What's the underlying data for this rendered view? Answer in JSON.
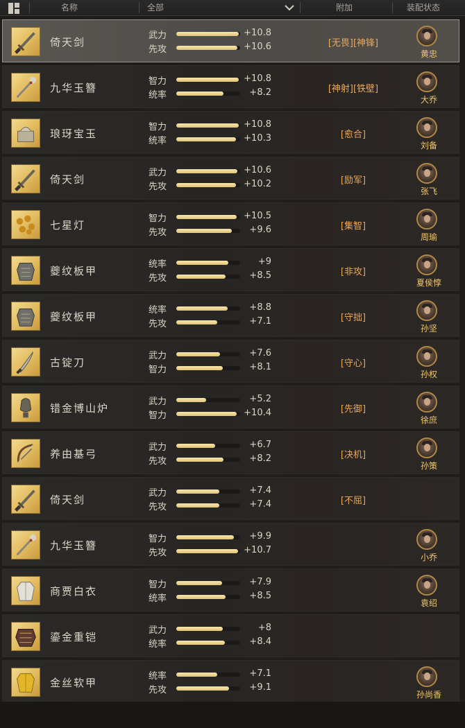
{
  "header": {
    "name_col": "名称",
    "filter_value": "全部",
    "extra_col": "附加",
    "equip_col": "装配状态",
    "layout_icon": "grid-toggle-icon",
    "dropdown_icon": "chevron-down-icon"
  },
  "colors": {
    "bar_fill": "#e8cc82",
    "tag_text": "#e8a85a",
    "owner_text": "#f0c86a",
    "selected_row": "#55524d"
  },
  "items": [
    {
      "name": "倚天剑",
      "icon": "sword-icon",
      "stats": [
        {
          "label": "武力",
          "value": "+10.8",
          "fill": 0.98
        },
        {
          "label": "先攻",
          "value": "+10.6",
          "fill": 0.96
        }
      ],
      "tags": "[无畏][神锋]",
      "owner": "黄忠",
      "selected": true
    },
    {
      "name": "九华玉簪",
      "icon": "hairpin-icon",
      "stats": [
        {
          "label": "智力",
          "value": "+10.8",
          "fill": 0.98
        },
        {
          "label": "统率",
          "value": "+8.2",
          "fill": 0.74
        }
      ],
      "tags": "[神射][铁壁]",
      "owner": "大乔"
    },
    {
      "name": "琅玡宝玉",
      "icon": "jade-seal-icon",
      "stats": [
        {
          "label": "智力",
          "value": "+10.8",
          "fill": 0.98
        },
        {
          "label": "统率",
          "value": "+10.3",
          "fill": 0.94
        }
      ],
      "tags": "[愈合]",
      "owner": "刘备"
    },
    {
      "name": "倚天剑",
      "icon": "sword-icon",
      "stats": [
        {
          "label": "武力",
          "value": "+10.6",
          "fill": 0.96
        },
        {
          "label": "先攻",
          "value": "+10.2",
          "fill": 0.93
        }
      ],
      "tags": "[励军]",
      "owner": "张飞"
    },
    {
      "name": "七星灯",
      "icon": "lamp-icon",
      "stats": [
        {
          "label": "智力",
          "value": "+10.5",
          "fill": 0.95
        },
        {
          "label": "先攻",
          "value": "+9.6",
          "fill": 0.87
        }
      ],
      "tags": "[集智]",
      "owner": "周瑜"
    },
    {
      "name": "夔纹板甲",
      "icon": "armor-icon",
      "stats": [
        {
          "label": "统率",
          "value": "+9",
          "fill": 0.82
        },
        {
          "label": "先攻",
          "value": "+8.5",
          "fill": 0.77
        }
      ],
      "tags": "[非攻]",
      "owner": "夏侯惇"
    },
    {
      "name": "夔纹板甲",
      "icon": "armor-icon",
      "stats": [
        {
          "label": "统率",
          "value": "+8.8",
          "fill": 0.8
        },
        {
          "label": "先攻",
          "value": "+7.1",
          "fill": 0.64
        }
      ],
      "tags": "[守拙]",
      "owner": "孙坚"
    },
    {
      "name": "古锭刀",
      "icon": "blade-icon",
      "stats": [
        {
          "label": "武力",
          "value": "+7.6",
          "fill": 0.69
        },
        {
          "label": "智力",
          "value": "+8.1",
          "fill": 0.73
        }
      ],
      "tags": "[守心]",
      "owner": "孙权"
    },
    {
      "name": "错金博山炉",
      "icon": "censer-icon",
      "stats": [
        {
          "label": "武力",
          "value": "+5.2",
          "fill": 0.47
        },
        {
          "label": "智力",
          "value": "+10.4",
          "fill": 0.95
        }
      ],
      "tags": "[先御]",
      "owner": "徐庶"
    },
    {
      "name": "养由基弓",
      "icon": "bow-icon",
      "stats": [
        {
          "label": "武力",
          "value": "+6.7",
          "fill": 0.61
        },
        {
          "label": "先攻",
          "value": "+8.2",
          "fill": 0.74
        }
      ],
      "tags": "[决机]",
      "owner": "孙策"
    },
    {
      "name": "倚天剑",
      "icon": "sword-icon",
      "stats": [
        {
          "label": "武力",
          "value": "+7.4",
          "fill": 0.67
        },
        {
          "label": "先攻",
          "value": "+7.4",
          "fill": 0.67
        }
      ],
      "tags": "[不屈]",
      "owner": ""
    },
    {
      "name": "九华玉簪",
      "icon": "hairpin-icon",
      "stats": [
        {
          "label": "智力",
          "value": "+9.9",
          "fill": 0.9
        },
        {
          "label": "先攻",
          "value": "+10.7",
          "fill": 0.97
        }
      ],
      "tags": "",
      "owner": "小乔"
    },
    {
      "name": "商贾白衣",
      "icon": "robe-icon",
      "stats": [
        {
          "label": "智力",
          "value": "+7.9",
          "fill": 0.72
        },
        {
          "label": "统率",
          "value": "+8.5",
          "fill": 0.77
        }
      ],
      "tags": "",
      "owner": "袁绍"
    },
    {
      "name": "鎏金重铠",
      "icon": "heavy-armor-icon",
      "stats": [
        {
          "label": "武力",
          "value": "+8",
          "fill": 0.73
        },
        {
          "label": "统率",
          "value": "+8.4",
          "fill": 0.76
        }
      ],
      "tags": "",
      "owner": ""
    },
    {
      "name": "金丝软甲",
      "icon": "gold-vest-icon",
      "stats": [
        {
          "label": "统率",
          "value": "+7.1",
          "fill": 0.64
        },
        {
          "label": "先攻",
          "value": "+9.1",
          "fill": 0.83
        }
      ],
      "tags": "",
      "owner": "孙尚香"
    }
  ]
}
